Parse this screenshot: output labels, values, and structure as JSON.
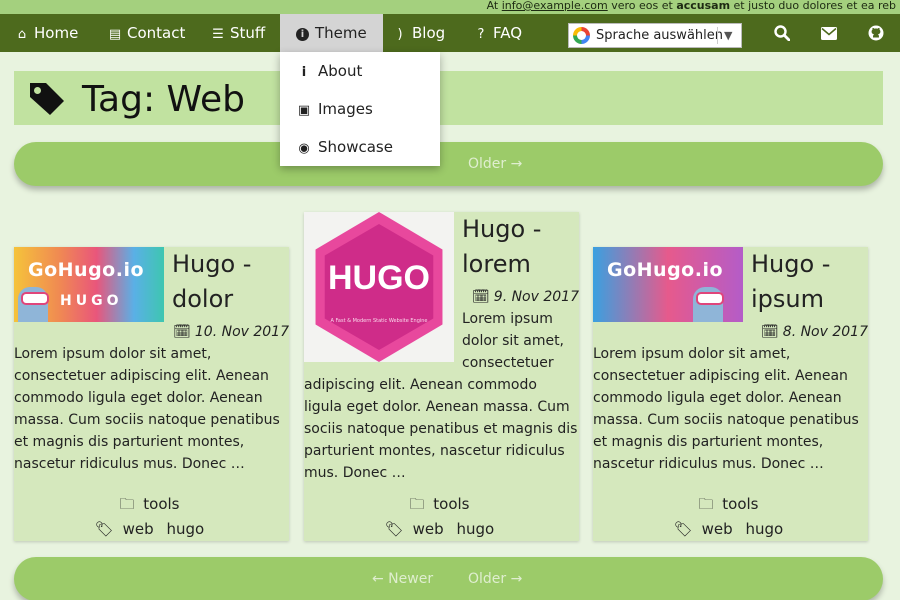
{
  "topbar": {
    "prefix": "At ",
    "email": "info@example.com",
    "mid": " vero eos et ",
    "bold": "accusam",
    "suffix": " et justo duo dolores et ea reb"
  },
  "nav": {
    "home": "Home",
    "contact": "Contact",
    "stuff": "Stuff",
    "theme": "Theme",
    "blog": "Blog",
    "faq": "FAQ",
    "language": "Sprache auswählen"
  },
  "dropdown": [
    {
      "label": "About",
      "icon": "info-icon"
    },
    {
      "label": "Images",
      "icon": "images-icon"
    },
    {
      "label": "Showcase",
      "icon": "eye-icon"
    }
  ],
  "page": {
    "title": "Tag: Web"
  },
  "pager_top": {
    "older": "Older →"
  },
  "pager_bottom": {
    "newer": "← Newer",
    "older": "Older →"
  },
  "posts": [
    {
      "title_line1": "Hugo -",
      "title_line2": "dolor",
      "date": "10. Nov 2017",
      "excerpt": "Lorem ipsum dolor sit amet, consectetuer adipiscing elit. Aenean commodo ligula eget dolor. Aenean massa. Cum sociis natoque penatibus et magnis dis parturient montes, nascetur ridiculus mus. Donec …",
      "category": "tools",
      "tags": [
        "web",
        "hugo"
      ],
      "image": {
        "line1": "GoHugo.io",
        "line2": "HUGO"
      }
    },
    {
      "title_line1": "Hugo -",
      "title_line2": "lorem",
      "date": "9. Nov 2017",
      "excerpt": "Lorem ipsum dolor sit amet, consectetuer adipiscing elit. Aenean commodo ligula eget dolor. Aenean massa. Cum sociis natoque penatibus et magnis dis parturient montes, nascetur ridiculus mus. Donec …",
      "category": "tools",
      "tags": [
        "web",
        "hugo"
      ],
      "image": {
        "line1": "HUGO",
        "line2": "A Fast & Modern Static Website Engine"
      }
    },
    {
      "title_line1": "Hugo -",
      "title_line2": "ipsum",
      "date": "8. Nov 2017",
      "excerpt": "Lorem ipsum dolor sit amet, consectetuer adipiscing elit. Aenean commodo ligula eget dolor. Aenean massa. Cum sociis natoque penatibus et magnis dis parturient montes, nascetur ridiculus mus. Donec …",
      "category": "tools",
      "tags": [
        "web",
        "hugo"
      ],
      "image": {
        "line1": "GoHugo.io"
      }
    }
  ],
  "colors": {
    "navbar": "#4d6a1d",
    "topbar": "#a4d07e",
    "page_bg": "#e8f3df",
    "card_bg": "#d5e8bd",
    "header_bg": "#c1e2a0",
    "pager_bg": "#9ccb69"
  }
}
